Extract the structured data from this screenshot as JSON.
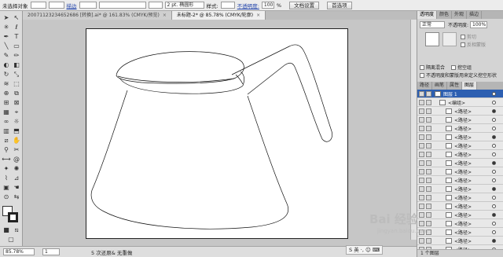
{
  "control_bar": {
    "selection_label": "未选择对象",
    "stroke_label": "描边",
    "stroke_width": "2 pt. 椭圆形",
    "style_label": "样式:",
    "opacity_label": "不透明度:",
    "opacity_value": "100",
    "opacity_unit": "%",
    "doc_setup_button": "文档设置",
    "prefs_button": "首选项"
  },
  "tabs": [
    {
      "label": "20071123234652686 [转换].ai* @ 161.83% (CMYK/预览)",
      "close": "×"
    },
    {
      "label": "未标题-2* @ 85.78% (CMYK/轮廓)",
      "close": "×"
    }
  ],
  "status_bar": {
    "zoom": "85.78%",
    "page": "1",
    "tool_info": "5 次还原& 无重做"
  },
  "right_panel": {
    "top_tabs": [
      "透明度",
      "颜色",
      "外观",
      "描边"
    ],
    "blend_mode": "正常",
    "opacity_label": "不透明度:",
    "opacity_value": "100%",
    "clip_label": "剪切",
    "invert_label": "反相蒙版",
    "isolate_label": "隔离混合",
    "knockout_label": "挖空组",
    "opacity_mask_label": "不透明度和蒙版用来定义挖空形状",
    "mid_tabs": [
      "路径",
      "画笔",
      "属性",
      "图层"
    ]
  },
  "layers": {
    "layer_name": "图层 1",
    "group_name": "<编组>",
    "path_label": "<路径>",
    "path_count": 17,
    "footer": "1 个图层"
  },
  "watermark": {
    "text": "Bai 经验",
    "url": "jingyan.baidu.com"
  },
  "ime": {
    "label": "S 英 ·, ☺ ⌨"
  }
}
